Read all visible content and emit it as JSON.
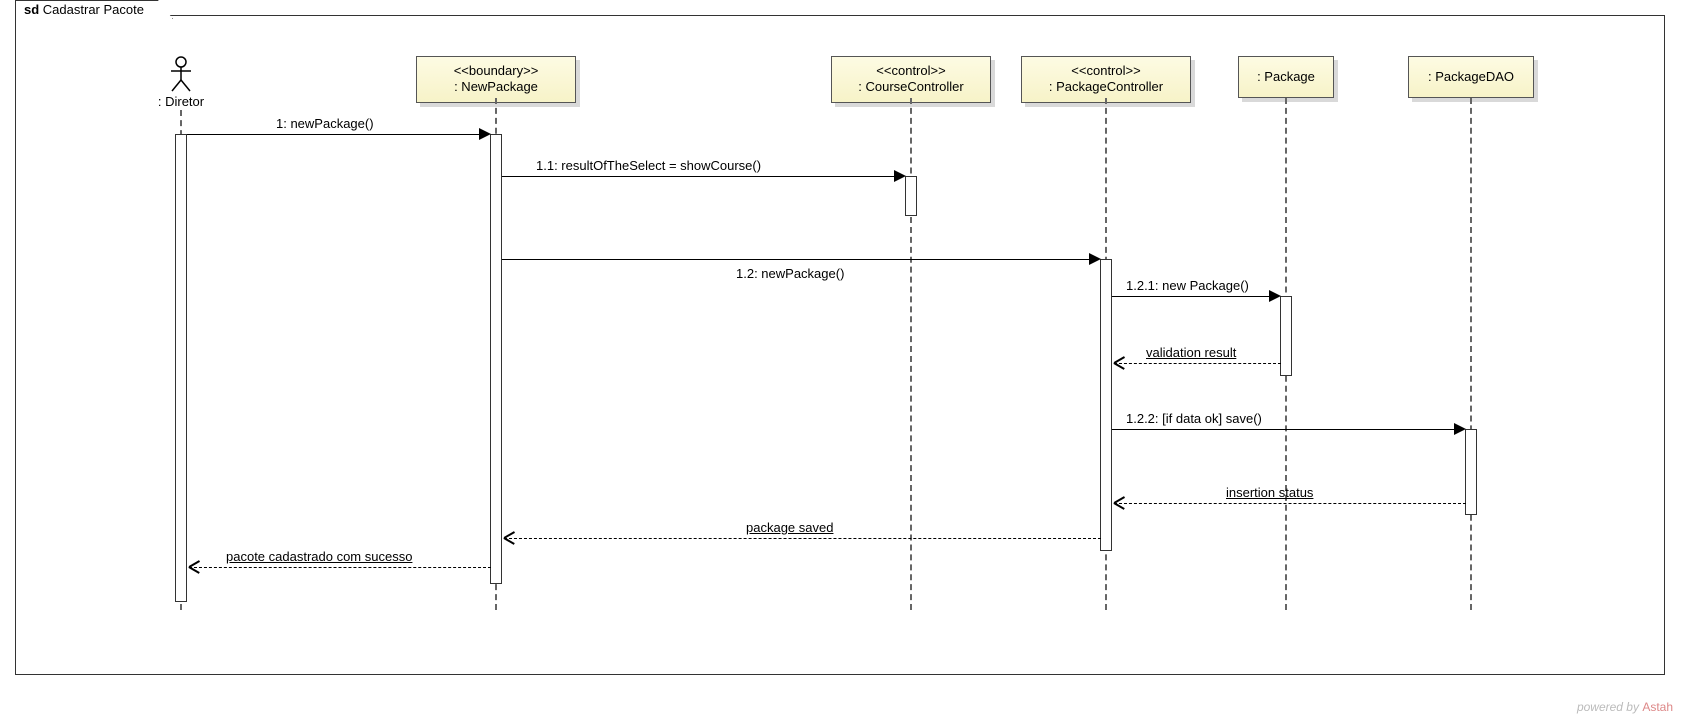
{
  "frame": {
    "prefix": "sd",
    "title": "Cadastrar Pacote"
  },
  "lifelines": {
    "actor": {
      "label": ": Diretor"
    },
    "l1": {
      "stereo": "<<boundary>>",
      "name": ": NewPackage"
    },
    "l2": {
      "stereo": "<<control>>",
      "name": ": CourseController"
    },
    "l3": {
      "stereo": "<<control>>",
      "name": ": PackageController"
    },
    "l4": {
      "stereo": "",
      "name": ": Package"
    },
    "l5": {
      "stereo": "",
      "name": ": PackageDAO"
    }
  },
  "messages": {
    "m1": "1: newPackage()",
    "m11": "1.1: resultOfTheSelect = showCourse()",
    "m12": "1.2: newPackage()",
    "m121": "1.2.1: new Package()",
    "r121": "validation result",
    "m122": "1.2.2: [if data ok] save()",
    "r122": "insertion status",
    "r12": "package saved",
    "r1": "pacote cadastrado com sucesso"
  },
  "watermark": {
    "text": "powered by ",
    "brand": "Astah"
  }
}
